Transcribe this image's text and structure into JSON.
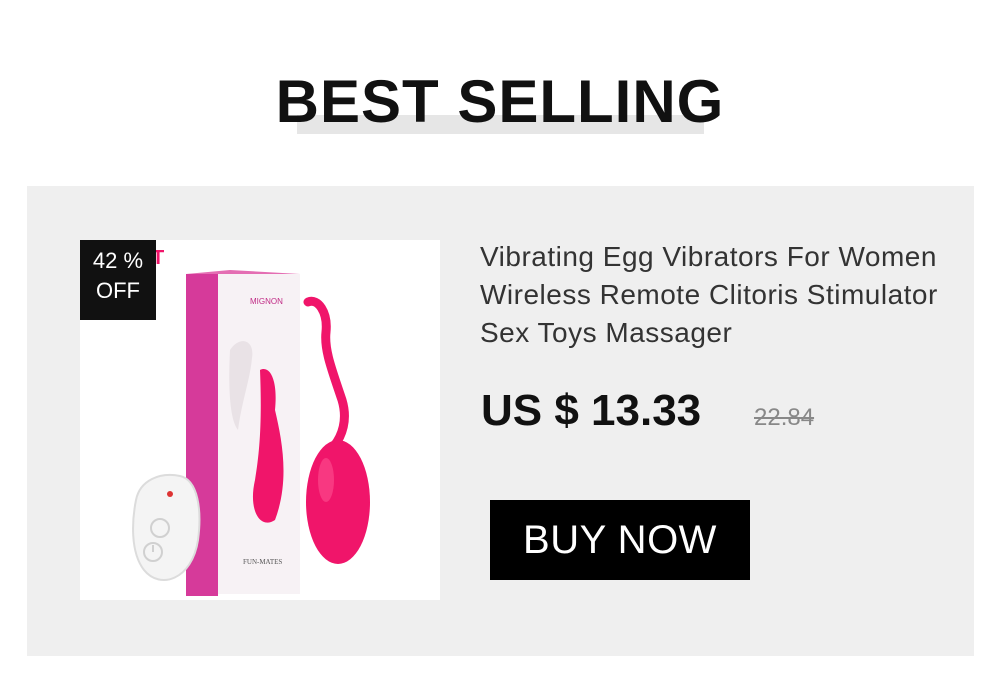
{
  "section": {
    "title": "BEST SELLING"
  },
  "product": {
    "title": "Vibrating Egg Vibrators For Women Wireless Remote Clitoris Stimulator Sex Toys Massager",
    "discount_percent": "42 %",
    "discount_label": "OFF",
    "price": "US $ 13.33",
    "original_price": "22.84",
    "buy_label": "BUY NOW",
    "image": {
      "box_brand_text": "MIGNON",
      "box_logo_text": "FUN-MATES",
      "brand_fragment": "T",
      "product_color": "#f0156a",
      "box_color": "#d63a9a"
    }
  },
  "colors": {
    "panel_bg": "#efefef",
    "button_bg": "#000000",
    "badge_bg": "#111111"
  }
}
